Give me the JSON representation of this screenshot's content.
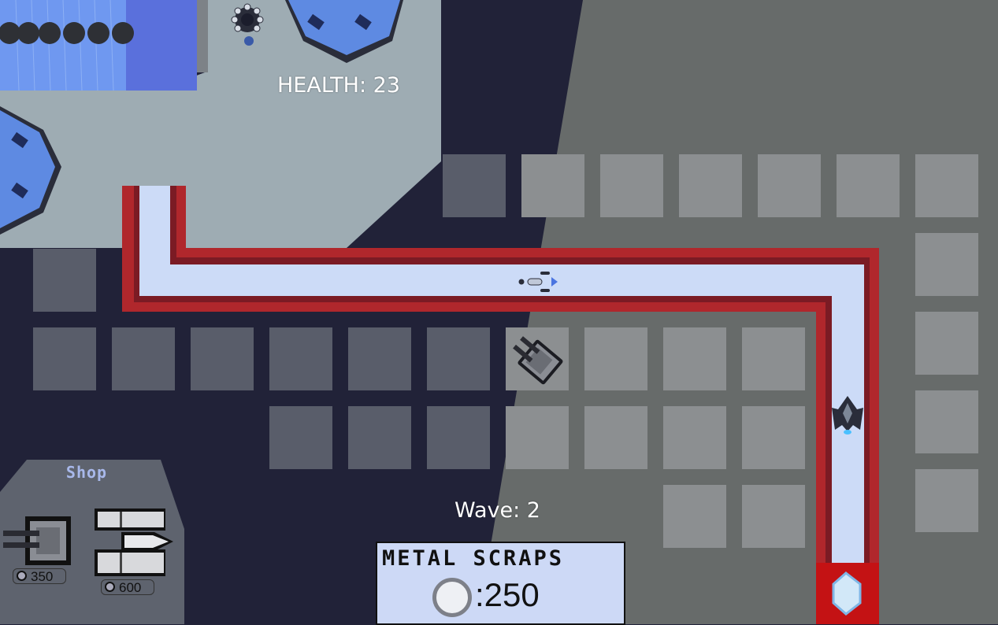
{
  "hud": {
    "health_label": "HEALTH: 23",
    "wave_label": "Wave: 2"
  },
  "resources": {
    "title": "METAL SCRAPS",
    "value": ":250"
  },
  "shop": {
    "title": "Shop",
    "items": [
      {
        "name": "cannon-turret",
        "icon": "twin-cannon-turret-icon",
        "price": "350"
      },
      {
        "name": "missile-turret",
        "icon": "missile-launcher-icon",
        "price": "600"
      }
    ]
  },
  "colors": {
    "path_fill": "#ccdbf7",
    "path_border": "#a0272c",
    "base_panel": "#9eacb3",
    "build_slot": "#8c8f91"
  }
}
